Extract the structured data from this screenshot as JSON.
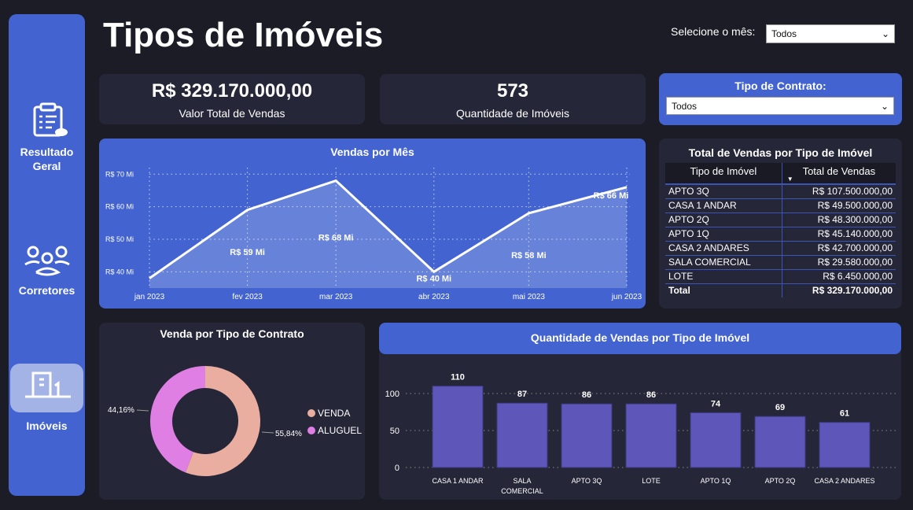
{
  "title": "Tipos de Imóveis",
  "sidebar": {
    "items": [
      {
        "label": "Resultado Geral",
        "icon": "clipboard-icon"
      },
      {
        "label": "Corretores",
        "icon": "people-icon"
      },
      {
        "label": "Imóveis",
        "icon": "building-icon",
        "active": true
      }
    ]
  },
  "month_filter": {
    "label": "Selecione o mês:",
    "value": "Todos"
  },
  "contract_filter": {
    "label": "Tipo de Contrato:",
    "value": "Todos"
  },
  "kpis": [
    {
      "value": "R$ 329.170.000,00",
      "label": "Valor Total de Vendas"
    },
    {
      "value": "573",
      "label": "Quantidade de Imóveis"
    }
  ],
  "colors": {
    "blue": "#4263d0",
    "bar": "#5e56b9",
    "venda": "#e9aea0",
    "aluguel": "#e07fe3"
  },
  "table": {
    "title": "Total de Vendas por Tipo de Imóvel",
    "headers": [
      "Tipo de Imóvel",
      "Total de Vendas"
    ],
    "rows": [
      [
        "APTO 3Q",
        "R$ 107.500.000,00"
      ],
      [
        "CASA 1 ANDAR",
        "R$ 49.500.000,00"
      ],
      [
        "APTO 2Q",
        "R$ 48.300.000,00"
      ],
      [
        "APTO 1Q",
        "R$ 45.140.000,00"
      ],
      [
        "CASA 2 ANDARES",
        "R$ 42.700.000,00"
      ],
      [
        "SALA COMERCIAL",
        "R$ 29.580.000,00"
      ],
      [
        "LOTE",
        "R$ 6.450.000,00"
      ]
    ],
    "total": [
      "Total",
      "R$ 329.170.000,00"
    ]
  },
  "chart_data": [
    {
      "type": "area",
      "title": "Vendas por Mês",
      "categories": [
        "jan 2023",
        "fev 2023",
        "mar 2023",
        "abr 2023",
        "mai 2023",
        "jun 2023"
      ],
      "day_offsets": [
        0,
        31,
        59,
        90,
        120,
        151
      ],
      "values": [
        38,
        59,
        68,
        40,
        58,
        66
      ],
      "labels": [
        "",
        "R$ 59 Mi",
        "R$ 68 Mi",
        "R$ 40 Mi",
        "R$ 58 Mi",
        "R$ 66 Mi"
      ],
      "yticks": [
        40,
        50,
        60,
        70
      ],
      "ytick_labels": [
        "R$ 40 Mi",
        "R$ 50 Mi",
        "R$ 60 Mi",
        "R$ 70 Mi"
      ],
      "ylim": [
        35,
        72
      ],
      "unit": "R$ Mi"
    },
    {
      "type": "pie",
      "title": "Venda por Tipo de Contrato",
      "slices": [
        {
          "name": "VENDA",
          "value": 55.84,
          "label": "55,84%"
        },
        {
          "name": "ALUGUEL",
          "value": 44.16,
          "label": "44,16%"
        }
      ],
      "legend": "right"
    },
    {
      "type": "bar",
      "title": "Quantidade de Vendas por Tipo de Imóvel",
      "categories": [
        "CASA 1 ANDAR",
        "SALA COMERCIAL",
        "APTO 3Q",
        "LOTE",
        "APTO 1Q",
        "APTO 2Q",
        "CASA 2 ANDARES"
      ],
      "values": [
        110,
        87,
        86,
        86,
        74,
        69,
        61
      ],
      "yticks": [
        0,
        50,
        100
      ],
      "ylim": [
        0,
        115
      ]
    }
  ]
}
